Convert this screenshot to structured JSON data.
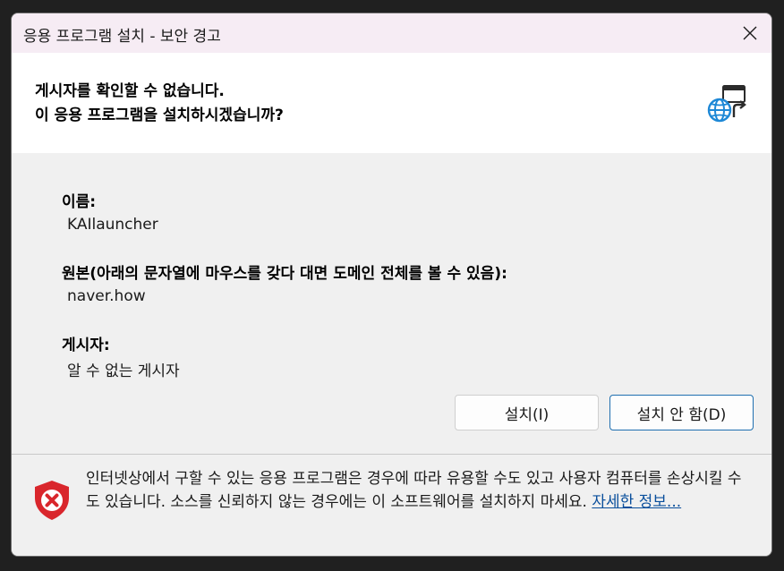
{
  "window": {
    "title": "응용 프로그램 설치 - 보안 경고"
  },
  "header": {
    "line1": "게시자를 확인할 수 없습니다.",
    "line2": "이 응용 프로그램을 설치하시겠습니까?"
  },
  "fields": {
    "name_label": "이름:",
    "name_value": "KAIlauncher",
    "origin_label": "원본(아래의 문자열에 마우스를 갖다 대면 도메인 전체를 볼 수 있음):",
    "origin_value": "naver.how",
    "publisher_label": "게시자:",
    "publisher_value": "알 수 없는 게시자"
  },
  "buttons": {
    "install": "설치(I)",
    "dont_install": "설치 안 함(D)"
  },
  "footer": {
    "warning": "인터넷상에서 구할 수 있는 응용 프로그램은 경우에 따라 유용할 수도 있고 사용자 컴퓨터를 손상시킬 수도 있습니다. 소스를 신뢰하지 않는 경우에는 이 소프트웨어를 설치하지 마세요.",
    "more_info": "자세한 정보..."
  },
  "icons": {
    "close": "close-icon",
    "header": "globe-install-icon",
    "warning": "shield-error-icon"
  },
  "colors": {
    "titlebar": "#f6ecf4",
    "shield": "#d9262c",
    "globe": "#1e88d6",
    "primary_border": "#1f6fb0",
    "link": "#0a4f9c"
  }
}
